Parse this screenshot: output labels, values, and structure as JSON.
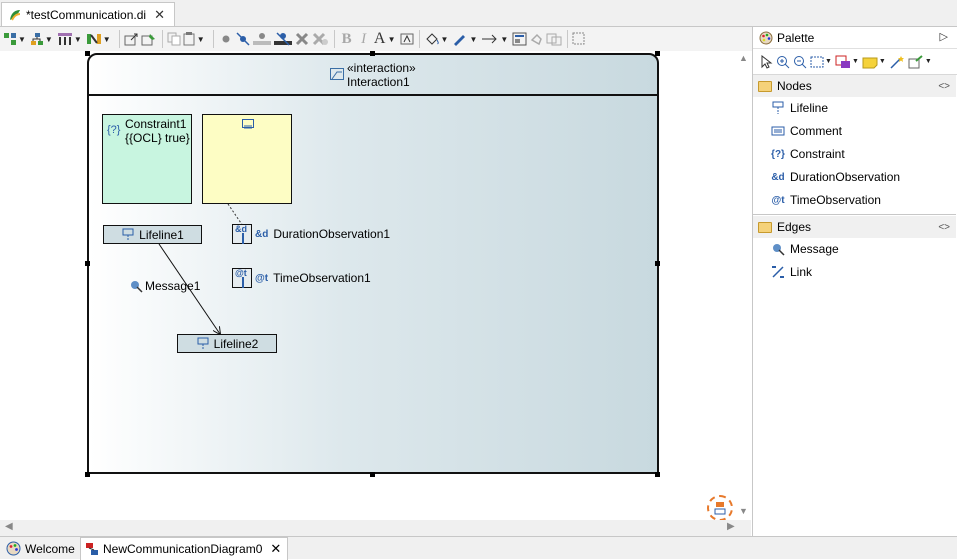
{
  "editor": {
    "tab_label": "*testCommunication.di",
    "close_glyph": "✕"
  },
  "toolbar": {
    "font_bold": "B",
    "font_italic": "I",
    "font_color": "A"
  },
  "diagram": {
    "interaction": {
      "stereotype": "«interaction»",
      "name": "Interaction1"
    },
    "constraint": {
      "name": "Constraint1",
      "specification": "{{OCL} true}",
      "icon": "{?}"
    },
    "lifelines": [
      {
        "name": "Lifeline1"
      },
      {
        "name": "Lifeline2"
      }
    ],
    "duration_observation": {
      "name": "DurationObservation1",
      "icon": "&d"
    },
    "time_observation": {
      "name": "TimeObservation1",
      "icon": "@t"
    },
    "message": {
      "name": "Message1"
    }
  },
  "palette": {
    "title": "Palette",
    "drawers": [
      {
        "label": "Nodes",
        "items": [
          {
            "label": "Lifeline",
            "icon": "lifeline-icon"
          },
          {
            "label": "Comment",
            "icon": "comment-icon"
          },
          {
            "label": "Constraint",
            "icon": "{?}"
          },
          {
            "label": "DurationObservation",
            "icon": "&d"
          },
          {
            "label": "TimeObservation",
            "icon": "@t"
          }
        ]
      },
      {
        "label": "Edges",
        "items": [
          {
            "label": "Message",
            "icon": "message-icon"
          },
          {
            "label": "Link",
            "icon": "link-icon"
          }
        ]
      }
    ]
  },
  "bottom_tabs": {
    "welcome": "Welcome",
    "diagram": "NewCommunicationDiagram0",
    "close_glyph": "✕"
  },
  "colors": {
    "interaction_gradient_end": "#c8d9df",
    "constraint_fill": "#c8f5e0",
    "comment_fill": "#fdfdc4",
    "lifeline_fill": "#cfdde2",
    "accent_blue": "#2b5ea8",
    "outline_orange": "#e7792b"
  }
}
